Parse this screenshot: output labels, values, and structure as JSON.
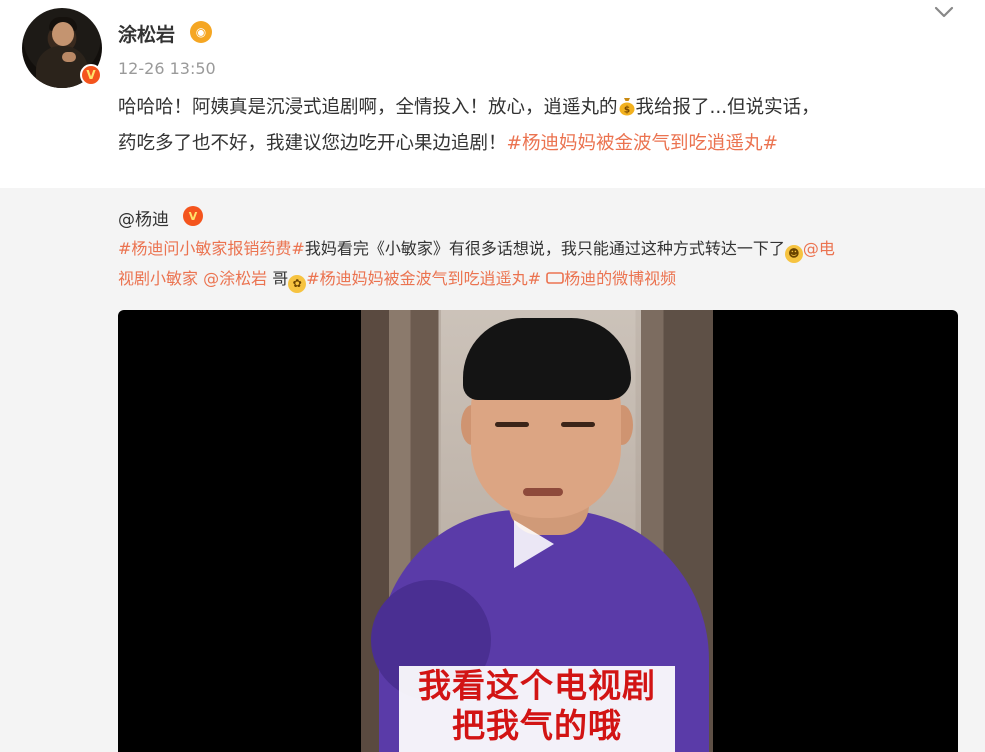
{
  "post": {
    "username": "涂松岩",
    "timestamp": "12-26 13:50",
    "content": {
      "line1_a": "哈哈哈！阿姨真是沉浸式追剧啊，全情投入！放心，逍遥丸的",
      "line1_b": "我给报了...但说实话，",
      "line2_a": "药吃多了也不好，我建议您边吃开心果边追剧！",
      "line2_topic": "#杨迪妈妈被金波气到吃逍遥丸#"
    }
  },
  "repost": {
    "username": "@杨迪",
    "topic1": "#杨迪问小敏家报销药费#",
    "text1": "我妈看完《小敏家》有很多话想说，我只能通过这种方式转达一下了",
    "mention1_a": "@电",
    "mention1_b": "视剧小敏家",
    "mention2": "@涂松岩",
    "text2": "哥",
    "topic2": "#杨迪妈妈被金波气到吃逍遥丸#",
    "video_link": "杨迪的微博视频"
  },
  "video": {
    "caption_line1": "我看这个电视剧",
    "caption_line2": "把我气的哦"
  },
  "colors": {
    "topic": "#eb7350",
    "background_repost": "#f4f4f4",
    "verified_badge": "#f4541d",
    "shirt": "#5a3ba8",
    "caption": "#d21414"
  },
  "icons": [
    "avatar",
    "verified-badge-icon",
    "member-icon",
    "chevron-down-icon",
    "money-bag-icon",
    "laugh-emoji-icon",
    "flower-emoji-icon",
    "video-link-icon",
    "play-icon"
  ]
}
